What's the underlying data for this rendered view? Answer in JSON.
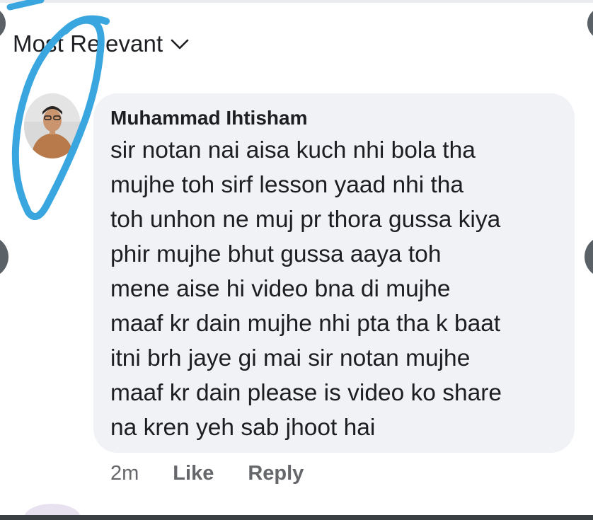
{
  "sort": {
    "label": "Most Relevant"
  },
  "comment": {
    "author": "Muhammad Ihtisham",
    "lines": [
      "sir notan nai aisa kuch nhi bola tha",
      "mujhe toh sirf lesson yaad nhi tha",
      "toh unhon ne muj pr thora gussa kiya",
      "phir mujhe bhut gussa aaya toh",
      "mene aise hi video bna di mujhe",
      "maaf kr dain mujhe nhi pta tha k baat",
      "itni brh jaye gi mai sir notan mujhe",
      "maaf kr dain please is video ko share",
      "na kren yeh sab jhoot hai"
    ],
    "time": "2m",
    "like_label": "Like",
    "reply_label": "Reply"
  },
  "icons": {
    "sort_chevron": "chevron-down-icon"
  },
  "colors": {
    "bubble": "#f0f2f5",
    "text": "#1c1e21",
    "meta": "#65676b",
    "annotation": "#3aa6e0"
  }
}
